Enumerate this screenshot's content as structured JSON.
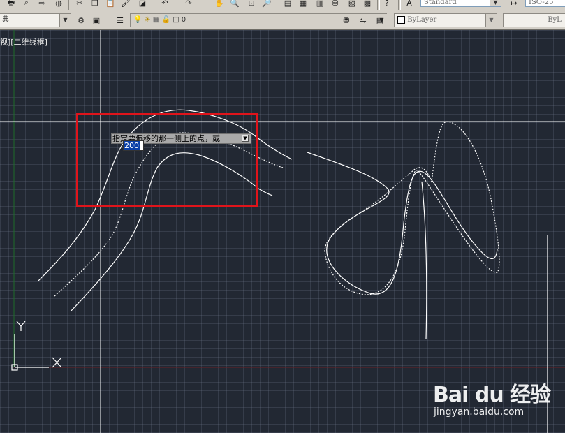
{
  "toolbar_top": {
    "text_style": "Standard",
    "dim_style": "ISO-25"
  },
  "toolbar_second": {
    "workspace_fragment": "典",
    "layer_name": "0",
    "color": "ByLayer",
    "linetype": "ByL"
  },
  "viewport": {
    "label": "视][二维线框]"
  },
  "command": {
    "prompt": "指定要偏移的那一侧上的点，或",
    "input_value": "200"
  },
  "ucs": {
    "x_label": "X",
    "y_label": "Y"
  },
  "watermark": {
    "logo_text": "Bai du 经验",
    "site": "jingyan.baidu.com"
  },
  "colors": {
    "background": "#222833",
    "grid": "#3a4250",
    "crosshair": "#ffffff",
    "highlight": "#e0141b",
    "y_axis": "#1f6b2a",
    "x_axis": "#6b1f24"
  }
}
